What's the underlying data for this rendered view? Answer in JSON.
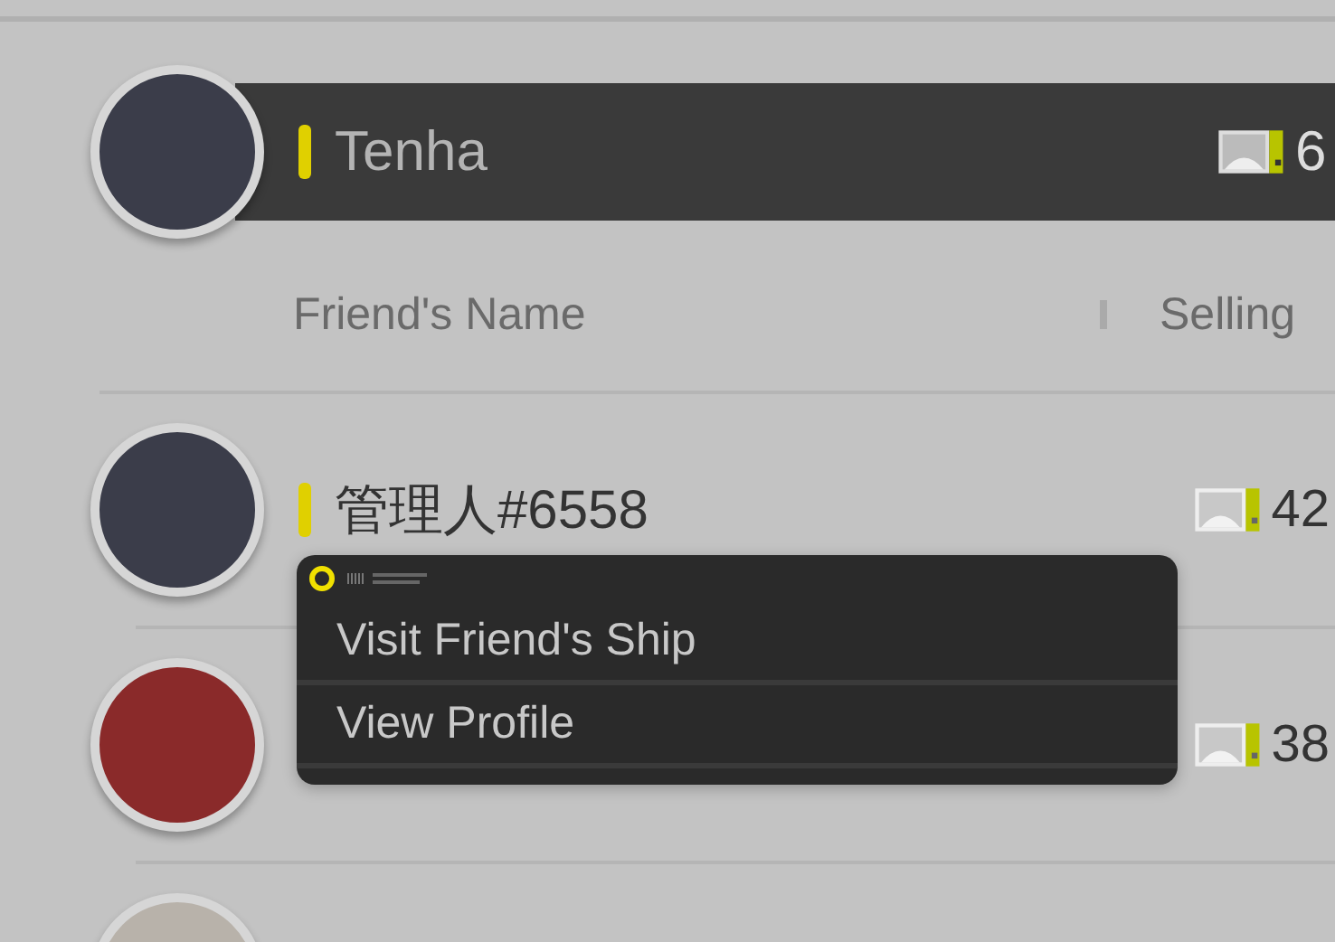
{
  "header": {
    "name": "Tenha",
    "value": "6"
  },
  "columns": [
    {
      "label": "Friend's Name"
    },
    {
      "label": "Selling"
    }
  ],
  "friends": [
    {
      "kind": "friend",
      "name": "管理人#6558",
      "value": "42"
    },
    {
      "kind": "friend",
      "value": "38"
    },
    {
      "kind": "avatar_only"
    }
  ],
  "menu": {
    "items": [
      {
        "label": "Visit Friend's Ship"
      },
      {
        "label": "View Profile"
      }
    ]
  }
}
